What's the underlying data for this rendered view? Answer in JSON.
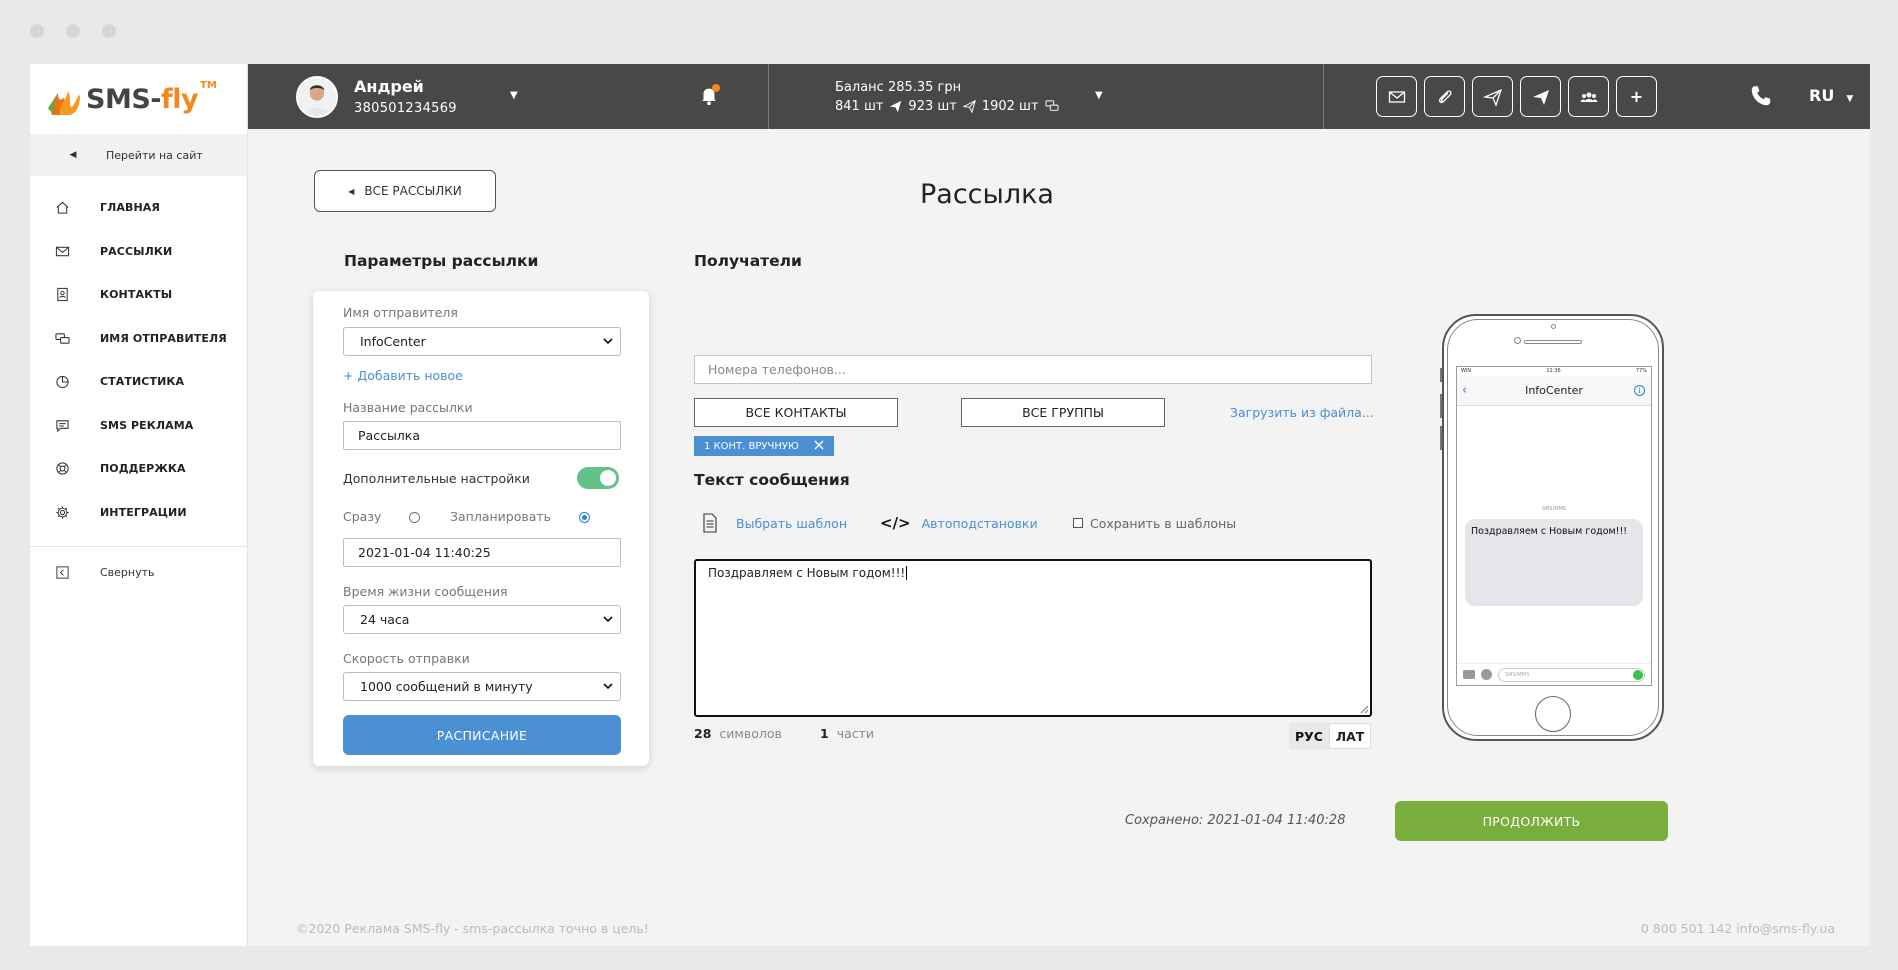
{
  "brand": {
    "name_part1": "SMS-",
    "name_part2": "fly",
    "tm": "TM"
  },
  "sidebar": {
    "goto_site": "Перейти на сайт",
    "items": [
      {
        "label": "ГЛАВНАЯ",
        "icon": "home-icon"
      },
      {
        "label": "РАССЫЛКИ",
        "icon": "envelope-icon"
      },
      {
        "label": "КОНТАКТЫ",
        "icon": "contacts-icon"
      },
      {
        "label": "ИМЯ ОТПРАВИТЕЛЯ",
        "icon": "chat-bubbles-icon"
      },
      {
        "label": "СТАТИСТИКА",
        "icon": "pie-chart-icon"
      },
      {
        "label": "SMS РЕКЛАМА",
        "icon": "message-icon"
      },
      {
        "label": "ПОДДЕРЖКА",
        "icon": "support-icon"
      },
      {
        "label": "ИНТЕГРАЦИИ",
        "icon": "gear-icon"
      }
    ],
    "collapse": "Свернуть"
  },
  "header": {
    "user_name": "Андрей",
    "user_phone": "380501234569",
    "balance_label": "Баланс 285.35 грн",
    "counts": [
      "841 шт",
      "923 шт",
      "1902 шт"
    ],
    "language": "RU",
    "tools": [
      "envelope-icon",
      "paperclip-icon",
      "send-outline-icon",
      "send-filled-icon",
      "group-icon",
      "plus-icon"
    ],
    "plus_label": "+"
  },
  "page": {
    "back_button": "ВСЕ РАССЫЛКИ",
    "title": "Рассылка"
  },
  "params": {
    "heading": "Параметры рассылки",
    "sender_label": "Имя отправителя",
    "sender_value": "InfoCenter",
    "add_new": "+ Добавить новое",
    "campaign_label": "Название рассылки",
    "campaign_value": "Рассылка",
    "extra_settings": "Дополнительные настройки",
    "extra_settings_on": true,
    "now_label": "Сразу",
    "schedule_label": "Запланировать",
    "schedule_selected": "Запланировать",
    "datetime": "2021-01-04 11:40:25",
    "ttl_label": "Время жизни сообщения",
    "ttl_value": "24 часа",
    "speed_label": "Скорость отправки",
    "speed_value": "1000 сообщений в минуту",
    "schedule_button": "РАСПИСАНИЕ"
  },
  "recipients": {
    "heading": "Получатели",
    "phones_placeholder": "Номера телефонов...",
    "all_contacts": "ВСЕ КОНТАКТЫ",
    "all_groups": "ВСЕ ГРУППЫ",
    "upload_file": "Загрузить из файла...",
    "chip": "1 КОНТ. ВРУЧНУЮ"
  },
  "message": {
    "heading": "Текст сообщения",
    "choose_template": "Выбрать шаблон",
    "autosubst": "Автоподстановки",
    "autosubst_glyph": "</>",
    "save_template": "Сохранить в шаблоны",
    "text": "Поздравляем с Новым годом!!!",
    "symbols_count": "28",
    "symbols_label": "символов",
    "parts_count": "1",
    "parts_label": "части",
    "alphabet_rus": "РУС",
    "alphabet_lat": "ЛАТ"
  },
  "preview": {
    "contact": "InfoCenter",
    "sms_label": "SMS/MMS",
    "bubble_text": "Поздравляем с Новым годом!!!",
    "composer_placeholder": "SMS/MMS",
    "time": "11:36",
    "carrier": "WIN",
    "battery": "77%"
  },
  "footer": {
    "saved": "Сохранено: 2021-01-04 11:40:28",
    "continue": "ПРОДОЛЖИТЬ",
    "copyright": "©2020 Реклама SMS-fly - sms-рассылка точно в цель!",
    "contacts": "0 800 501 142 info@sms-fly.ua"
  },
  "colors": {
    "header_bg": "#4a4847",
    "accent_orange": "#f08a1c",
    "link_blue": "#4a8fd2",
    "button_blue": "#4a90d2",
    "button_green": "#7aae3c",
    "toggle_green": "#63c28a"
  }
}
